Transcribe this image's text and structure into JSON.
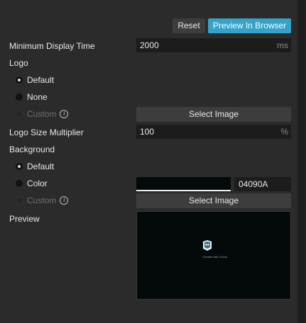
{
  "toolbar": {
    "reset_label": "Reset",
    "preview_label": "Preview In Browser"
  },
  "min_display": {
    "label": "Minimum Display Time",
    "value": "2000",
    "unit": "ms"
  },
  "logo": {
    "label": "Logo",
    "options": [
      {
        "label": "Default",
        "selected": true,
        "enabled": true
      },
      {
        "label": "None",
        "selected": false,
        "enabled": true
      },
      {
        "label": "Custom",
        "selected": false,
        "enabled": false
      }
    ],
    "select_image_label": "Select Image"
  },
  "logo_size": {
    "label": "Logo Size Multiplier",
    "value": "100",
    "unit": "%"
  },
  "background": {
    "label": "Background",
    "options": [
      {
        "label": "Default",
        "selected": true,
        "enabled": true
      },
      {
        "label": "Color",
        "selected": false,
        "enabled": true
      },
      {
        "label": "Custom",
        "selected": false,
        "enabled": false
      }
    ],
    "color_hex": "04090A",
    "select_image_label": "Select Image"
  },
  "preview": {
    "label": "Preview",
    "caption": "Created with Cocos"
  },
  "colors": {
    "accent": "#35a3c9",
    "panel": "#2b2b2b",
    "preview_bg": "#04090a"
  }
}
